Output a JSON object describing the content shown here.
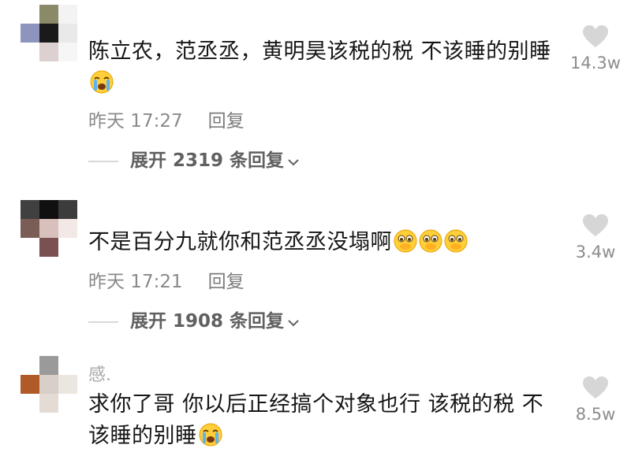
{
  "comments": [
    {
      "username": "",
      "text": "陈立农，范丞丞，黄明昊该税的税 不该睡的别睡",
      "emojis": [
        "crying-face"
      ],
      "time": "昨天 17:27",
      "reply_label": "回复",
      "likes": "14.3w",
      "expand_label": "展开 2319 条回复"
    },
    {
      "username": "",
      "text": "不是百分九就你和范丞丞没塌啊",
      "emojis": [
        "pleading-face",
        "pleading-face",
        "pleading-face"
      ],
      "time": "昨天 17:21",
      "reply_label": "回复",
      "likes": "3.4w",
      "expand_label": "展开 1908 条回复"
    },
    {
      "username": "感.",
      "text": "求你了哥 你以后正经搞个对象也行 该税的税 不该睡的别睡",
      "emojis": [
        "crying-face"
      ],
      "likes": "8.5w"
    }
  ],
  "colors": {
    "text": "#161616",
    "meta": "#8a8a8a",
    "like_icon": "#d6d6d6",
    "expand_text": "#606060"
  }
}
